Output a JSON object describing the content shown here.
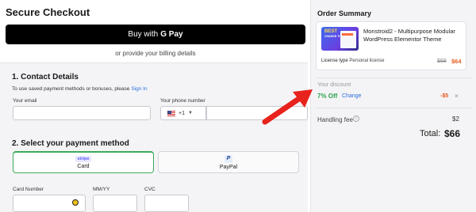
{
  "checkout": {
    "title": "Secure Checkout",
    "gpay_label": "Buy with",
    "gpay_brand": "G Pay",
    "or_text": "or provide your billing details"
  },
  "contact": {
    "title": "1. Contact Details",
    "hint_prefix": "To use saved payment methods or bonuses, please",
    "sign_in": "Sign In",
    "email_label": "Your email",
    "phone_label": "Your phone number",
    "phone_code": "+1"
  },
  "payment": {
    "title": "2. Select your payment method",
    "tabs": [
      {
        "logo": "stripe",
        "label": "Card"
      },
      {
        "logo": "P",
        "label": "PayPal"
      }
    ],
    "card_number_label": "Card Number",
    "expiry_label": "MM/YY",
    "cvc_label": "CVC"
  },
  "summary": {
    "title": "Order Summary",
    "product": {
      "thumb_title": "BEST",
      "thumb_sub": "CHANGE THE WORLD",
      "name": "Monstroid2 - Multipurpose Modular WordPress Elementor Theme",
      "license_label": "License type",
      "license_value": "Personal license",
      "price_old": "$69",
      "price_new": "$64"
    },
    "discount_label": "Your discount",
    "discount_value": "7% Off",
    "discount_change": "Change",
    "discount_amount": "-$5",
    "discount_remove": "×",
    "fee_label": "Handling fee",
    "fee_value": "$2",
    "total_label": "Total:",
    "total_value": "$66"
  },
  "colors": {
    "accent_green": "#2ea44f",
    "accent_orange": "#e85a1b",
    "link_blue": "#2d6cdf",
    "arrow_red": "#e8221c"
  }
}
